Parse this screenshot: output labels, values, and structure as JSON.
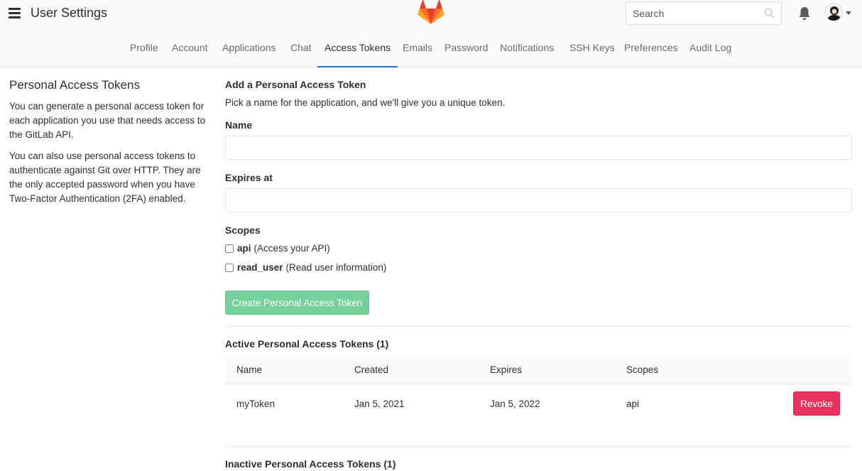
{
  "header": {
    "title": "User Settings",
    "search_placeholder": "Search"
  },
  "tabs": [
    {
      "label": "Profile"
    },
    {
      "label": "Account"
    },
    {
      "label": "Applications"
    },
    {
      "label": "Chat"
    },
    {
      "label": "Access Tokens",
      "active": true
    },
    {
      "label": "Emails"
    },
    {
      "label": "Password"
    },
    {
      "label": "Notifications"
    },
    {
      "label": "SSH Keys"
    },
    {
      "label": "Preferences"
    },
    {
      "label": "Audit Log"
    }
  ],
  "sidebar": {
    "heading": "Personal Access Tokens",
    "para1": "You can generate a personal access token for each application you use that needs access to the GitLab API.",
    "para2": "You can also use personal access tokens to authenticate against Git over HTTP. They are the only accepted password when you have Two-Factor Authentication (2FA) enabled."
  },
  "form": {
    "title": "Add a Personal Access Token",
    "subtitle": "Pick a name for the application, and we'll give you a unique token.",
    "name_label": "Name",
    "name_value": "",
    "expires_label": "Expires at",
    "expires_value": "",
    "scopes_label": "Scopes",
    "scopes": [
      {
        "name": "api",
        "desc": "(Access your API)",
        "checked": false
      },
      {
        "name": "read_user",
        "desc": "(Read user information)",
        "checked": false
      }
    ],
    "create_button": "Create Personal Access Token"
  },
  "active_tokens": {
    "title": "Active Personal Access Tokens (1)",
    "columns": [
      "Name",
      "Created",
      "Expires",
      "Scopes"
    ],
    "rows": [
      {
        "name": "myToken",
        "created": "Jan 5, 2021",
        "expires": "Jan 5, 2022",
        "scopes": "api",
        "action": "Revoke"
      }
    ]
  },
  "inactive_tokens": {
    "title": "Inactive Personal Access Tokens (1)"
  },
  "colors": {
    "accent": "#1f78d1",
    "create_button": "#75d09b",
    "revoke_button": "#e8315b"
  }
}
